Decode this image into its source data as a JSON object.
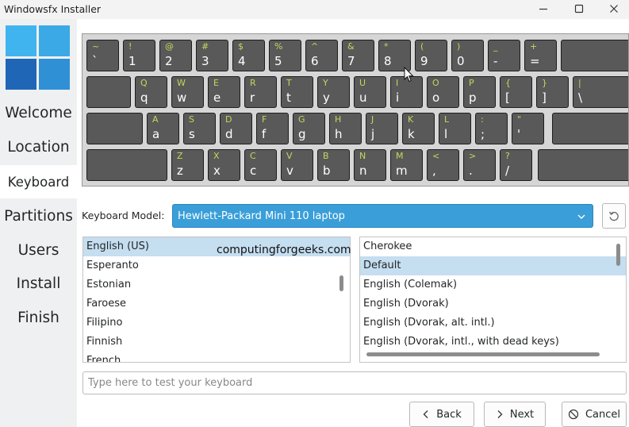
{
  "window": {
    "title": "Windowsfx Installer"
  },
  "sidebar": {
    "logo_colors": [
      "#40b4ef",
      "#3aa9e6",
      "#1f67b6",
      "#2f90d6"
    ],
    "steps": [
      {
        "label": "Welcome",
        "active": false
      },
      {
        "label": "Location",
        "active": false
      },
      {
        "label": "Keyboard",
        "active": true
      },
      {
        "label": "Partitions",
        "active": false
      },
      {
        "label": "Users",
        "active": false
      },
      {
        "label": "Install",
        "active": false
      },
      {
        "label": "Finish",
        "active": false
      }
    ]
  },
  "keyboard": {
    "rows": [
      {
        "keys": [
          [
            "~",
            "`"
          ],
          [
            "!",
            "1"
          ],
          [
            "@",
            "2"
          ],
          [
            "#",
            "3"
          ],
          [
            "$",
            "4"
          ],
          [
            "%",
            "5"
          ],
          [
            "^",
            "6"
          ],
          [
            "&",
            "7"
          ],
          [
            "*",
            "8"
          ],
          [
            "(",
            "9"
          ],
          [
            ")",
            "0"
          ],
          [
            "_",
            "-"
          ],
          [
            "+",
            "="
          ],
          [
            "",
            ""
          ]
        ]
      },
      {
        "keys": [
          [
            "",
            ""
          ],
          [
            "Q",
            "q"
          ],
          [
            "W",
            "w"
          ],
          [
            "E",
            "e"
          ],
          [
            "R",
            "r"
          ],
          [
            "T",
            "t"
          ],
          [
            "Y",
            "y"
          ],
          [
            "U",
            "u"
          ],
          [
            "I",
            "i"
          ],
          [
            "O",
            "o"
          ],
          [
            "P",
            "p"
          ],
          [
            "{",
            "["
          ],
          [
            "}",
            "]"
          ],
          [
            "|",
            "\\"
          ]
        ]
      },
      {
        "keys": [
          [
            "",
            ""
          ],
          [
            "A",
            "a"
          ],
          [
            "S",
            "s"
          ],
          [
            "D",
            "d"
          ],
          [
            "F",
            "f"
          ],
          [
            "G",
            "g"
          ],
          [
            "H",
            "h"
          ],
          [
            "J",
            "j"
          ],
          [
            "K",
            "k"
          ],
          [
            "L",
            "l"
          ],
          [
            ":",
            ";"
          ],
          [
            "\"",
            "'"
          ],
          [
            "",
            ""
          ]
        ]
      },
      {
        "keys": [
          [
            "",
            ""
          ],
          [
            "Z",
            "z"
          ],
          [
            "X",
            "x"
          ],
          [
            "C",
            "c"
          ],
          [
            "V",
            "v"
          ],
          [
            "B",
            "b"
          ],
          [
            "N",
            "n"
          ],
          [
            "M",
            "m"
          ],
          [
            "<",
            ","
          ],
          [
            ">",
            "."
          ],
          [
            "?",
            "/"
          ],
          [
            "",
            ""
          ]
        ]
      }
    ]
  },
  "model": {
    "label": "Keyboard Model:",
    "value": "Hewlett-Packard Mini 110 laptop"
  },
  "layouts": {
    "items": [
      "English (US)",
      "Esperanto",
      "Estonian",
      "Faroese",
      "Filipino",
      "Finnish",
      "French"
    ],
    "selected": "English (US)"
  },
  "variants": {
    "items": [
      "Cherokee",
      "Default",
      "English (Colemak)",
      "English (Dvorak)",
      "English (Dvorak, alt. intl.)",
      "English (Dvorak, intl., with dead keys)"
    ],
    "selected": "Default"
  },
  "watermark": "computingforgeeks.com",
  "test_field": {
    "value": "",
    "placeholder": "Type here to test your keyboard"
  },
  "buttons": {
    "back": "Back",
    "next": "Next",
    "cancel": "Cancel"
  },
  "colors": {
    "accent": "#3a9ed8",
    "selection": "#c5def0",
    "key": "#595959",
    "key_shift_label": "#c6d65c"
  }
}
